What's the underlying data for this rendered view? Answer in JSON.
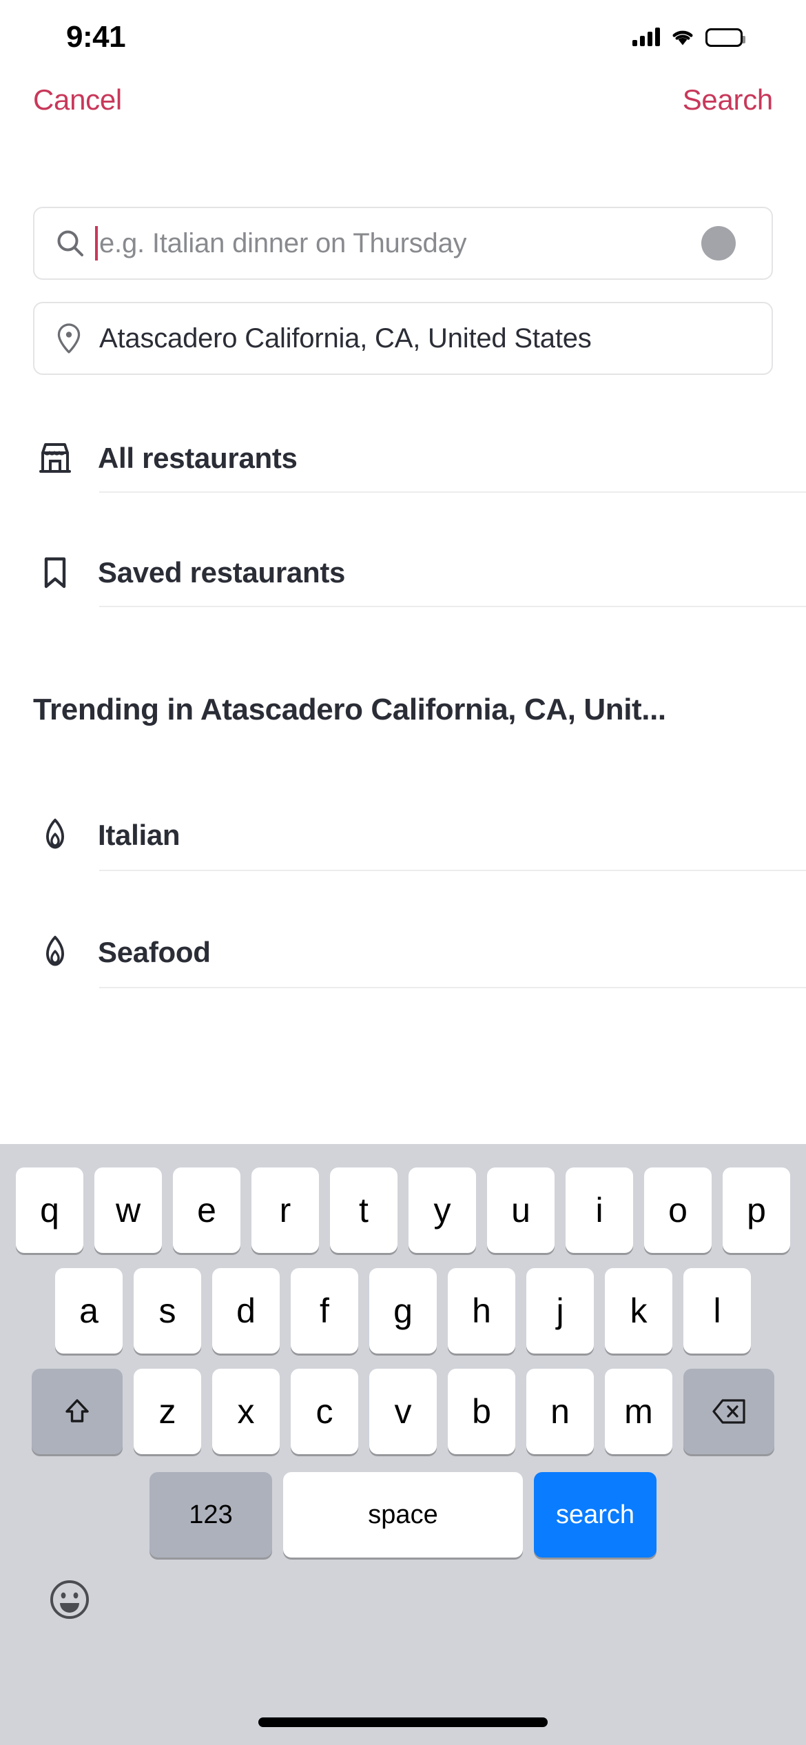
{
  "status_bar": {
    "time": "9:41",
    "signal_icon": "cellular-signal-icon",
    "wifi_icon": "wifi-icon",
    "battery_icon": "battery-full-icon"
  },
  "nav_bar": {
    "cancel_label": "Cancel",
    "search_label": "Search",
    "accent_color": "#C8385A"
  },
  "search_field": {
    "value": "",
    "placeholder": "e.g. Italian dinner on Thursday",
    "icon": "search-icon",
    "clear_button": "clear-icon",
    "caret_color": "#C8385A"
  },
  "location_field": {
    "value": "Atascadero California, CA, United States",
    "icon": "location-pin-icon"
  },
  "menu": {
    "items": [
      {
        "label": "All restaurants",
        "icon": "storefront-icon"
      },
      {
        "label": "Saved restaurants",
        "icon": "bookmark-icon"
      }
    ]
  },
  "trending": {
    "title": "Trending in Atascadero California, CA, Unit...",
    "items": [
      {
        "label": "Italian",
        "icon": "flame-icon"
      },
      {
        "label": "Seafood",
        "icon": "flame-icon"
      }
    ]
  },
  "keyboard": {
    "row1": [
      "q",
      "w",
      "e",
      "r",
      "t",
      "y",
      "u",
      "i",
      "o",
      "p"
    ],
    "row2": [
      "a",
      "s",
      "d",
      "f",
      "g",
      "h",
      "j",
      "k",
      "l"
    ],
    "row3": [
      "z",
      "x",
      "c",
      "v",
      "b",
      "n",
      "m"
    ],
    "shift_icon": "shift-arrow-icon",
    "backspace_icon": "backspace-delete-icon",
    "numbers_label": "123",
    "space_label": "space",
    "enter_label": "search",
    "enter_color": "#0A7CFF",
    "emoji_icon": "emoji-smiley-icon"
  },
  "home_indicator": "home-indicator-bar"
}
